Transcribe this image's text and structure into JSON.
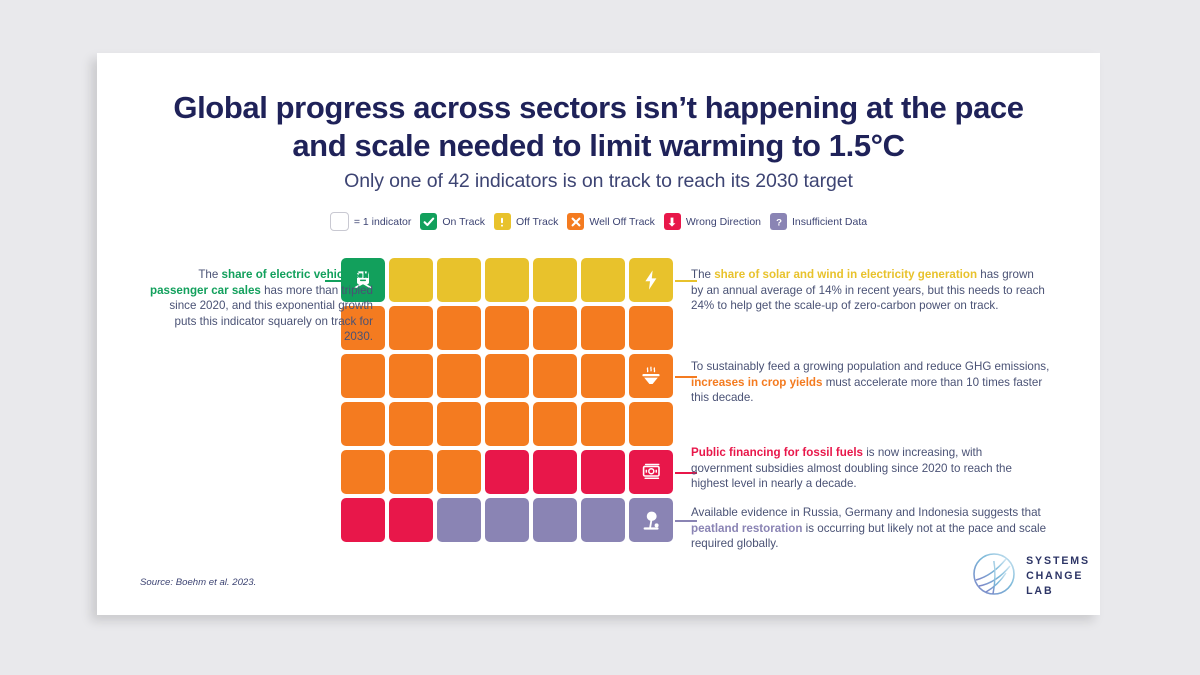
{
  "header": {
    "title_line1": "Global progress across sectors isn’t happening at the pace",
    "title_line2": "and scale needed to limit warming to 1.5°C",
    "subtitle": "Only one of 42 indicators is on track to reach its 2030 target"
  },
  "legend": [
    {
      "key": "one-indicator",
      "icon": "empty-square",
      "label": "= 1 indicator",
      "color": "#ffffff"
    },
    {
      "key": "on-track",
      "icon": "check-icon",
      "label": "On Track",
      "color": "#12a05c"
    },
    {
      "key": "off-track",
      "icon": "exclamation-icon",
      "label": "Off Track",
      "color": "#e8c22c"
    },
    {
      "key": "well-off-track",
      "icon": "cross-icon",
      "label": "Well Off Track",
      "color": "#f47b20"
    },
    {
      "key": "wrong-direction",
      "icon": "down-arrow-icon",
      "label": "Wrong Direction",
      "color": "#e8174a"
    },
    {
      "key": "insufficient-data",
      "icon": "question-icon",
      "label": "Insufficient Data",
      "color": "#8a84b4"
    }
  ],
  "chart_data": {
    "type": "waffle",
    "title": "Global progress across sectors isn’t happening at the pace and scale needed to limit warming to 1.5°C",
    "subtitle": "Only one of 42 indicators is on track to reach its 2030 target",
    "unit": "1 square = 1 indicator",
    "total_indicators": 42,
    "rows": 6,
    "columns": 7,
    "categories": [
      "On Track",
      "Off Track",
      "Well Off Track",
      "Wrong Direction",
      "Insufficient Data"
    ],
    "values": [
      1,
      6,
      24,
      6,
      5
    ],
    "colors": [
      "#12a05c",
      "#e8c22c",
      "#f47b20",
      "#e8174a",
      "#8a84b4"
    ],
    "cells": [
      "on-track",
      "off-track",
      "off-track",
      "off-track",
      "off-track",
      "off-track",
      "off-track",
      "well-off-track",
      "well-off-track",
      "well-off-track",
      "well-off-track",
      "well-off-track",
      "well-off-track",
      "well-off-track",
      "well-off-track",
      "well-off-track",
      "well-off-track",
      "well-off-track",
      "well-off-track",
      "well-off-track",
      "well-off-track",
      "well-off-track",
      "well-off-track",
      "well-off-track",
      "well-off-track",
      "well-off-track",
      "well-off-track",
      "well-off-track",
      "well-off-track",
      "well-off-track",
      "well-off-track",
      "wrong-direction",
      "wrong-direction",
      "wrong-direction",
      "wrong-direction",
      "wrong-direction",
      "wrong-direction",
      "insufficient-data",
      "insufficient-data",
      "insufficient-data",
      "insufficient-data",
      "insufficient-data"
    ],
    "marked_cells": [
      {
        "index": 0,
        "icon": "electric-vehicle-icon"
      },
      {
        "index": 6,
        "icon": "lightning-bolt-icon"
      },
      {
        "index": 20,
        "icon": "crop-bowl-icon"
      },
      {
        "index": 34,
        "icon": "banknote-icon"
      },
      {
        "index": 41,
        "icon": "peatland-icon"
      }
    ]
  },
  "annotations": {
    "ev": {
      "lead": "The ",
      "highlight": "share of electric vehicles in passenger car sales",
      "rest": " has more than tripled since 2020, and this exponential growth puts this indicator squarely on track for 2030.",
      "color": "#12a05c"
    },
    "solar": {
      "lead": "The ",
      "highlight": "share of solar and wind in electricity generation",
      "rest": " has grown by an annual average of 14% in recent years, but this needs to reach 24% to help get the scale-up of zero-carbon power on track.",
      "color": "#e8c22c"
    },
    "crop": {
      "lead": "To sustainably feed a growing population and reduce GHG emissions, ",
      "highlight": "increases in crop yields",
      "rest": " must accelerate more than 10 times faster this decade.",
      "color": "#f47b20"
    },
    "fossil": {
      "lead": "",
      "highlight": "Public financing for fossil fuels",
      "rest": " is now increasing, with government subsidies almost doubling since 2020 to reach the highest level in nearly a decade.",
      "color": "#e8174a"
    },
    "peat": {
      "lead": "Available evidence in Russia, Germany and Indonesia suggests that ",
      "highlight": "peatland restoration",
      "rest": " is occurring but likely not at the pace and scale required globally.",
      "color": "#8a84b4"
    }
  },
  "footer": {
    "source": "Source: Boehm et al. 2023.",
    "logo_line1": "SYSTEMS",
    "logo_line2": "CHANGE",
    "logo_line3": "LAB"
  }
}
